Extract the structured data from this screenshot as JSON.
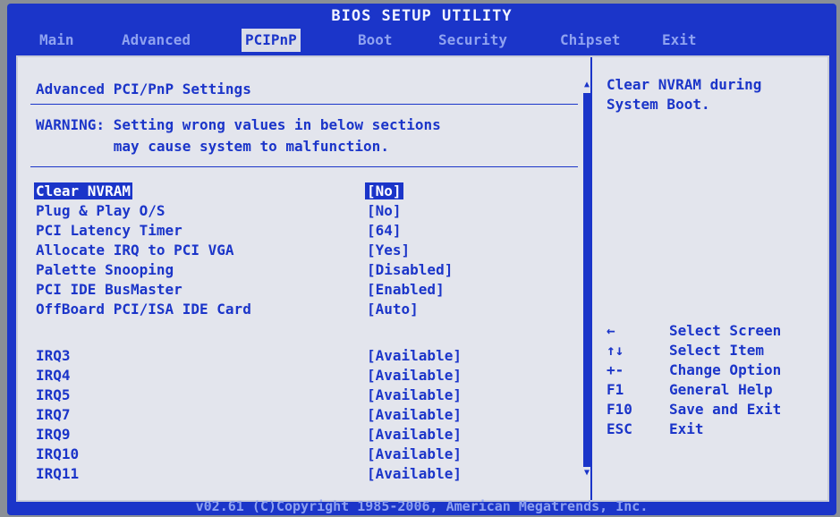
{
  "title": "BIOS SETUP UTILITY",
  "tabs": [
    "Main",
    "Advanced",
    "PCIPnP",
    "Boot",
    "Security",
    "Chipset",
    "Exit"
  ],
  "active_tab": "PCIPnP",
  "heading": "Advanced PCI/PnP Settings",
  "warning": "WARNING: Setting wrong values in below sections\n         may cause system to malfunction.",
  "settings": [
    {
      "label": "Clear NVRAM",
      "value": "[No]",
      "selected": true
    },
    {
      "label": "Plug & Play O/S",
      "value": "[No]"
    },
    {
      "label": "PCI Latency Timer",
      "value": "[64]"
    },
    {
      "label": "Allocate IRQ to PCI VGA",
      "value": "[Yes]"
    },
    {
      "label": "Palette Snooping",
      "value": "[Disabled]"
    },
    {
      "label": "PCI IDE BusMaster",
      "value": "[Enabled]"
    },
    {
      "label": "OffBoard PCI/ISA IDE Card",
      "value": "[Auto]"
    },
    {
      "label": "IRQ3",
      "value": "[Available]"
    },
    {
      "label": "IRQ4",
      "value": "[Available]"
    },
    {
      "label": "IRQ5",
      "value": "[Available]"
    },
    {
      "label": "IRQ7",
      "value": "[Available]"
    },
    {
      "label": "IRQ9",
      "value": "[Available]"
    },
    {
      "label": "IRQ10",
      "value": "[Available]"
    },
    {
      "label": "IRQ11",
      "value": "[Available]"
    }
  ],
  "help_text": "Clear NVRAM during System Boot.",
  "keys": [
    {
      "key": "←",
      "desc": "Select Screen"
    },
    {
      "key": "↑↓",
      "desc": "Select Item"
    },
    {
      "key": "+-",
      "desc": "Change Option"
    },
    {
      "key": "F1",
      "desc": "General Help"
    },
    {
      "key": "F10",
      "desc": "Save and Exit"
    },
    {
      "key": "ESC",
      "desc": "Exit"
    }
  ],
  "footer": "v02.61 (C)Copyright 1985-2006, American Megatrends, Inc.",
  "colors": {
    "bios_blue": "#1b35c9",
    "panel_bg": "#e3e5ed"
  }
}
